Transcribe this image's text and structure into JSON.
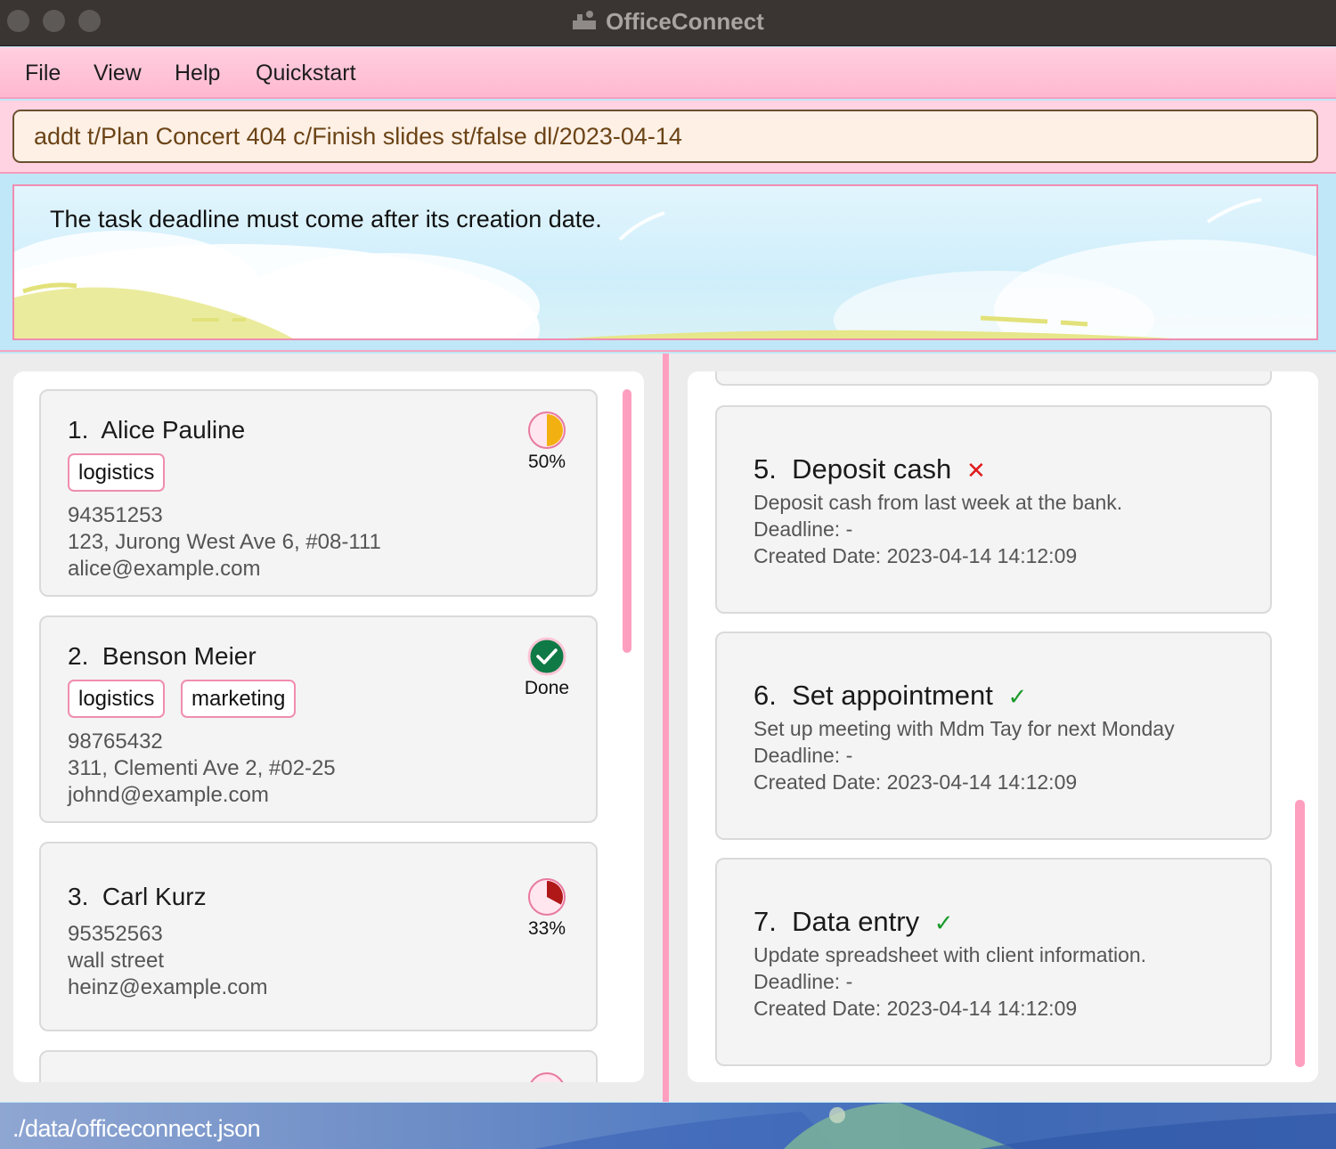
{
  "window": {
    "title": "OfficeConnect"
  },
  "menu": {
    "items": [
      "File",
      "View",
      "Help",
      "Quickstart"
    ]
  },
  "command": {
    "value": "addt t/Plan Concert 404 c/Finish slides st/false dl/2023-04-14"
  },
  "result": {
    "message": "The task deadline must come after its creation date."
  },
  "persons": [
    {
      "index": "1.",
      "name": "Alice Pauline",
      "tags": [
        "logistics"
      ],
      "phone": "94351253",
      "address": "123, Jurong West Ave 6, #08-111",
      "email": "alice@example.com",
      "progress": 0.5,
      "progress_label": "50%",
      "progress_color": "#f2b111"
    },
    {
      "index": "2.",
      "name": "Benson Meier",
      "tags": [
        "logistics",
        "marketing"
      ],
      "phone": "98765432",
      "address": "311, Clementi Ave 2, #02-25",
      "email": "johnd@example.com",
      "progress": 1.0,
      "progress_label": "Done",
      "progress_color": "#0f7a45"
    },
    {
      "index": "3.",
      "name": "Carl Kurz",
      "tags": [],
      "phone": "95352563",
      "address": "wall street",
      "email": "heinz@example.com",
      "progress": 0.33,
      "progress_label": "33%",
      "progress_color": "#b01818"
    }
  ],
  "tasks": [
    {
      "index": "5.",
      "title": "Deposit cash",
      "status": "not-done",
      "status_mark": "✕",
      "description": "Deposit cash from last week at the bank.",
      "deadline": "Deadline: -",
      "created": "Created Date: 2023-04-14 14:12:09"
    },
    {
      "index": "6.",
      "title": "Set appointment",
      "status": "done",
      "status_mark": "✓",
      "description": "Set up meeting with Mdm Tay for next Monday",
      "deadline": "Deadline: -",
      "created": "Created Date: 2023-04-14 14:12:09"
    },
    {
      "index": "7.",
      "title": "Data entry",
      "status": "done",
      "status_mark": "✓",
      "description": "Update spreadsheet with client information.",
      "deadline": "Deadline: -",
      "created": "Created Date: 2023-04-14 14:12:09"
    }
  ],
  "status_bar": {
    "path": "./data/officeconnect.json"
  },
  "colors": {
    "accent_pink": "#ff9fbf",
    "tag_border": "#f08db0",
    "command_text": "#6b4316"
  }
}
